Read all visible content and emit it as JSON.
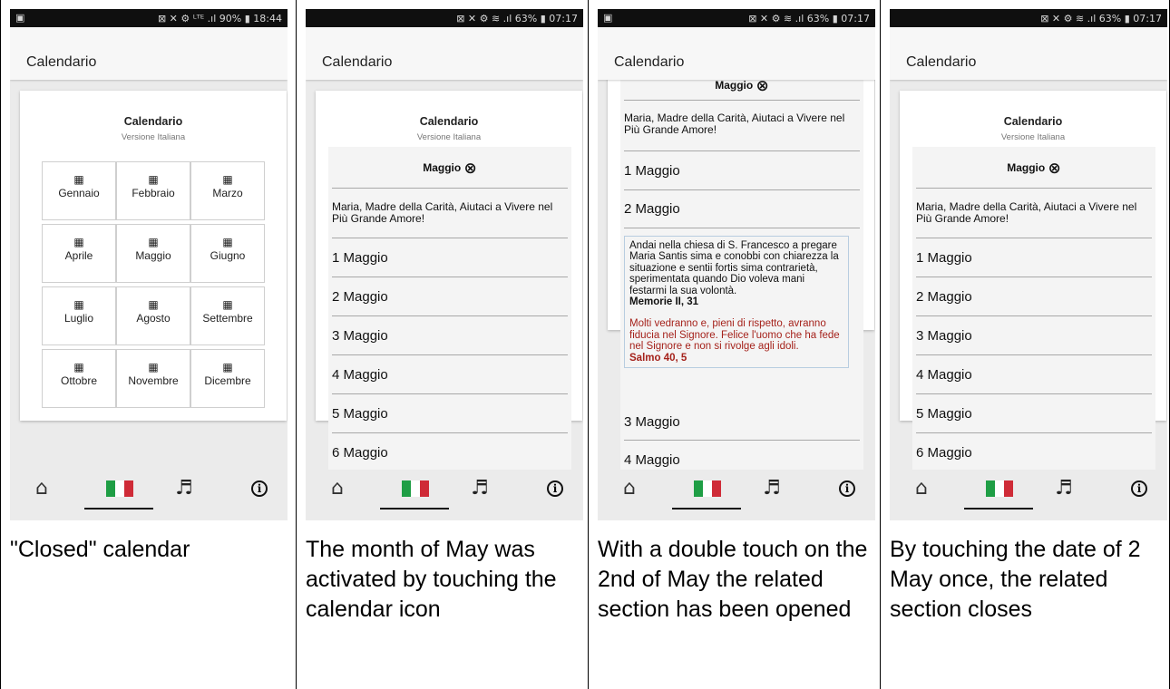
{
  "status_bars": [
    {
      "left": "▣",
      "right": "⊠ ✕ ⚙ ᴸᵀᴱ .ıl 90% ▮ 18:44"
    },
    {
      "left": "",
      "right": "⊠ ✕ ⚙ ≋ .ıl 63% ▮ 07:17"
    },
    {
      "left": "▣",
      "right": "⊠ ✕ ⚙ ≋ .ıl 63% ▮ 07:17"
    },
    {
      "left": "",
      "right": "⊠ ✕ ⚙ ≋ .ıl 63% ▮ 07:17"
    }
  ],
  "app_title": "Calendario",
  "card": {
    "title": "Calendario",
    "subtitle": "Versione Italiana",
    "calendar_glyph": "▦"
  },
  "months": [
    "Gennaio",
    "Febbraio",
    "Marzo",
    "Aprile",
    "Maggio",
    "Giugno",
    "Luglio",
    "Agosto",
    "Settembre",
    "Ottobre",
    "Novembre",
    "Dicembre"
  ],
  "panel": {
    "month": "Maggio",
    "close_glyph": "⊗",
    "quote": "Maria, Madre della Carità, Aiutaci a Vivere nel Più Grande Amore!"
  },
  "days": [
    "1 Maggio",
    "2 Maggio",
    "3 Maggio",
    "4 Maggio",
    "5 Maggio",
    "6 Maggio"
  ],
  "detail": {
    "text": "Andai nella chiesa di S. Francesco a pregare Maria Santis sima e conobbi con chiarezza la situazione e sentii fortis sima contrarietà, sperimentata quando Dio voleva mani festarmi la sua volontà.",
    "ref": "Memorie II, 31",
    "psalm": "Molti vedranno e, pieni di rispetto, avranno fiducia nel Signore. Felice l'uomo che ha fede nel Signore e non si rivolge agli idoli.",
    "psalm_ref": "Salmo 40, 5"
  },
  "nav": {
    "home_glyph": "⌂",
    "music_glyph": "♬",
    "info_glyph": "i",
    "flag_colors": [
      "#1f9e45",
      "#ffffff",
      "#cf2b37"
    ]
  },
  "captions": [
    "\"Closed\" calendar",
    "The month of May was activated by touching the calendar icon",
    "With a double touch on the 2nd of May the related section has been opened",
    "By touching the date of 2 May once, the related section closes"
  ]
}
